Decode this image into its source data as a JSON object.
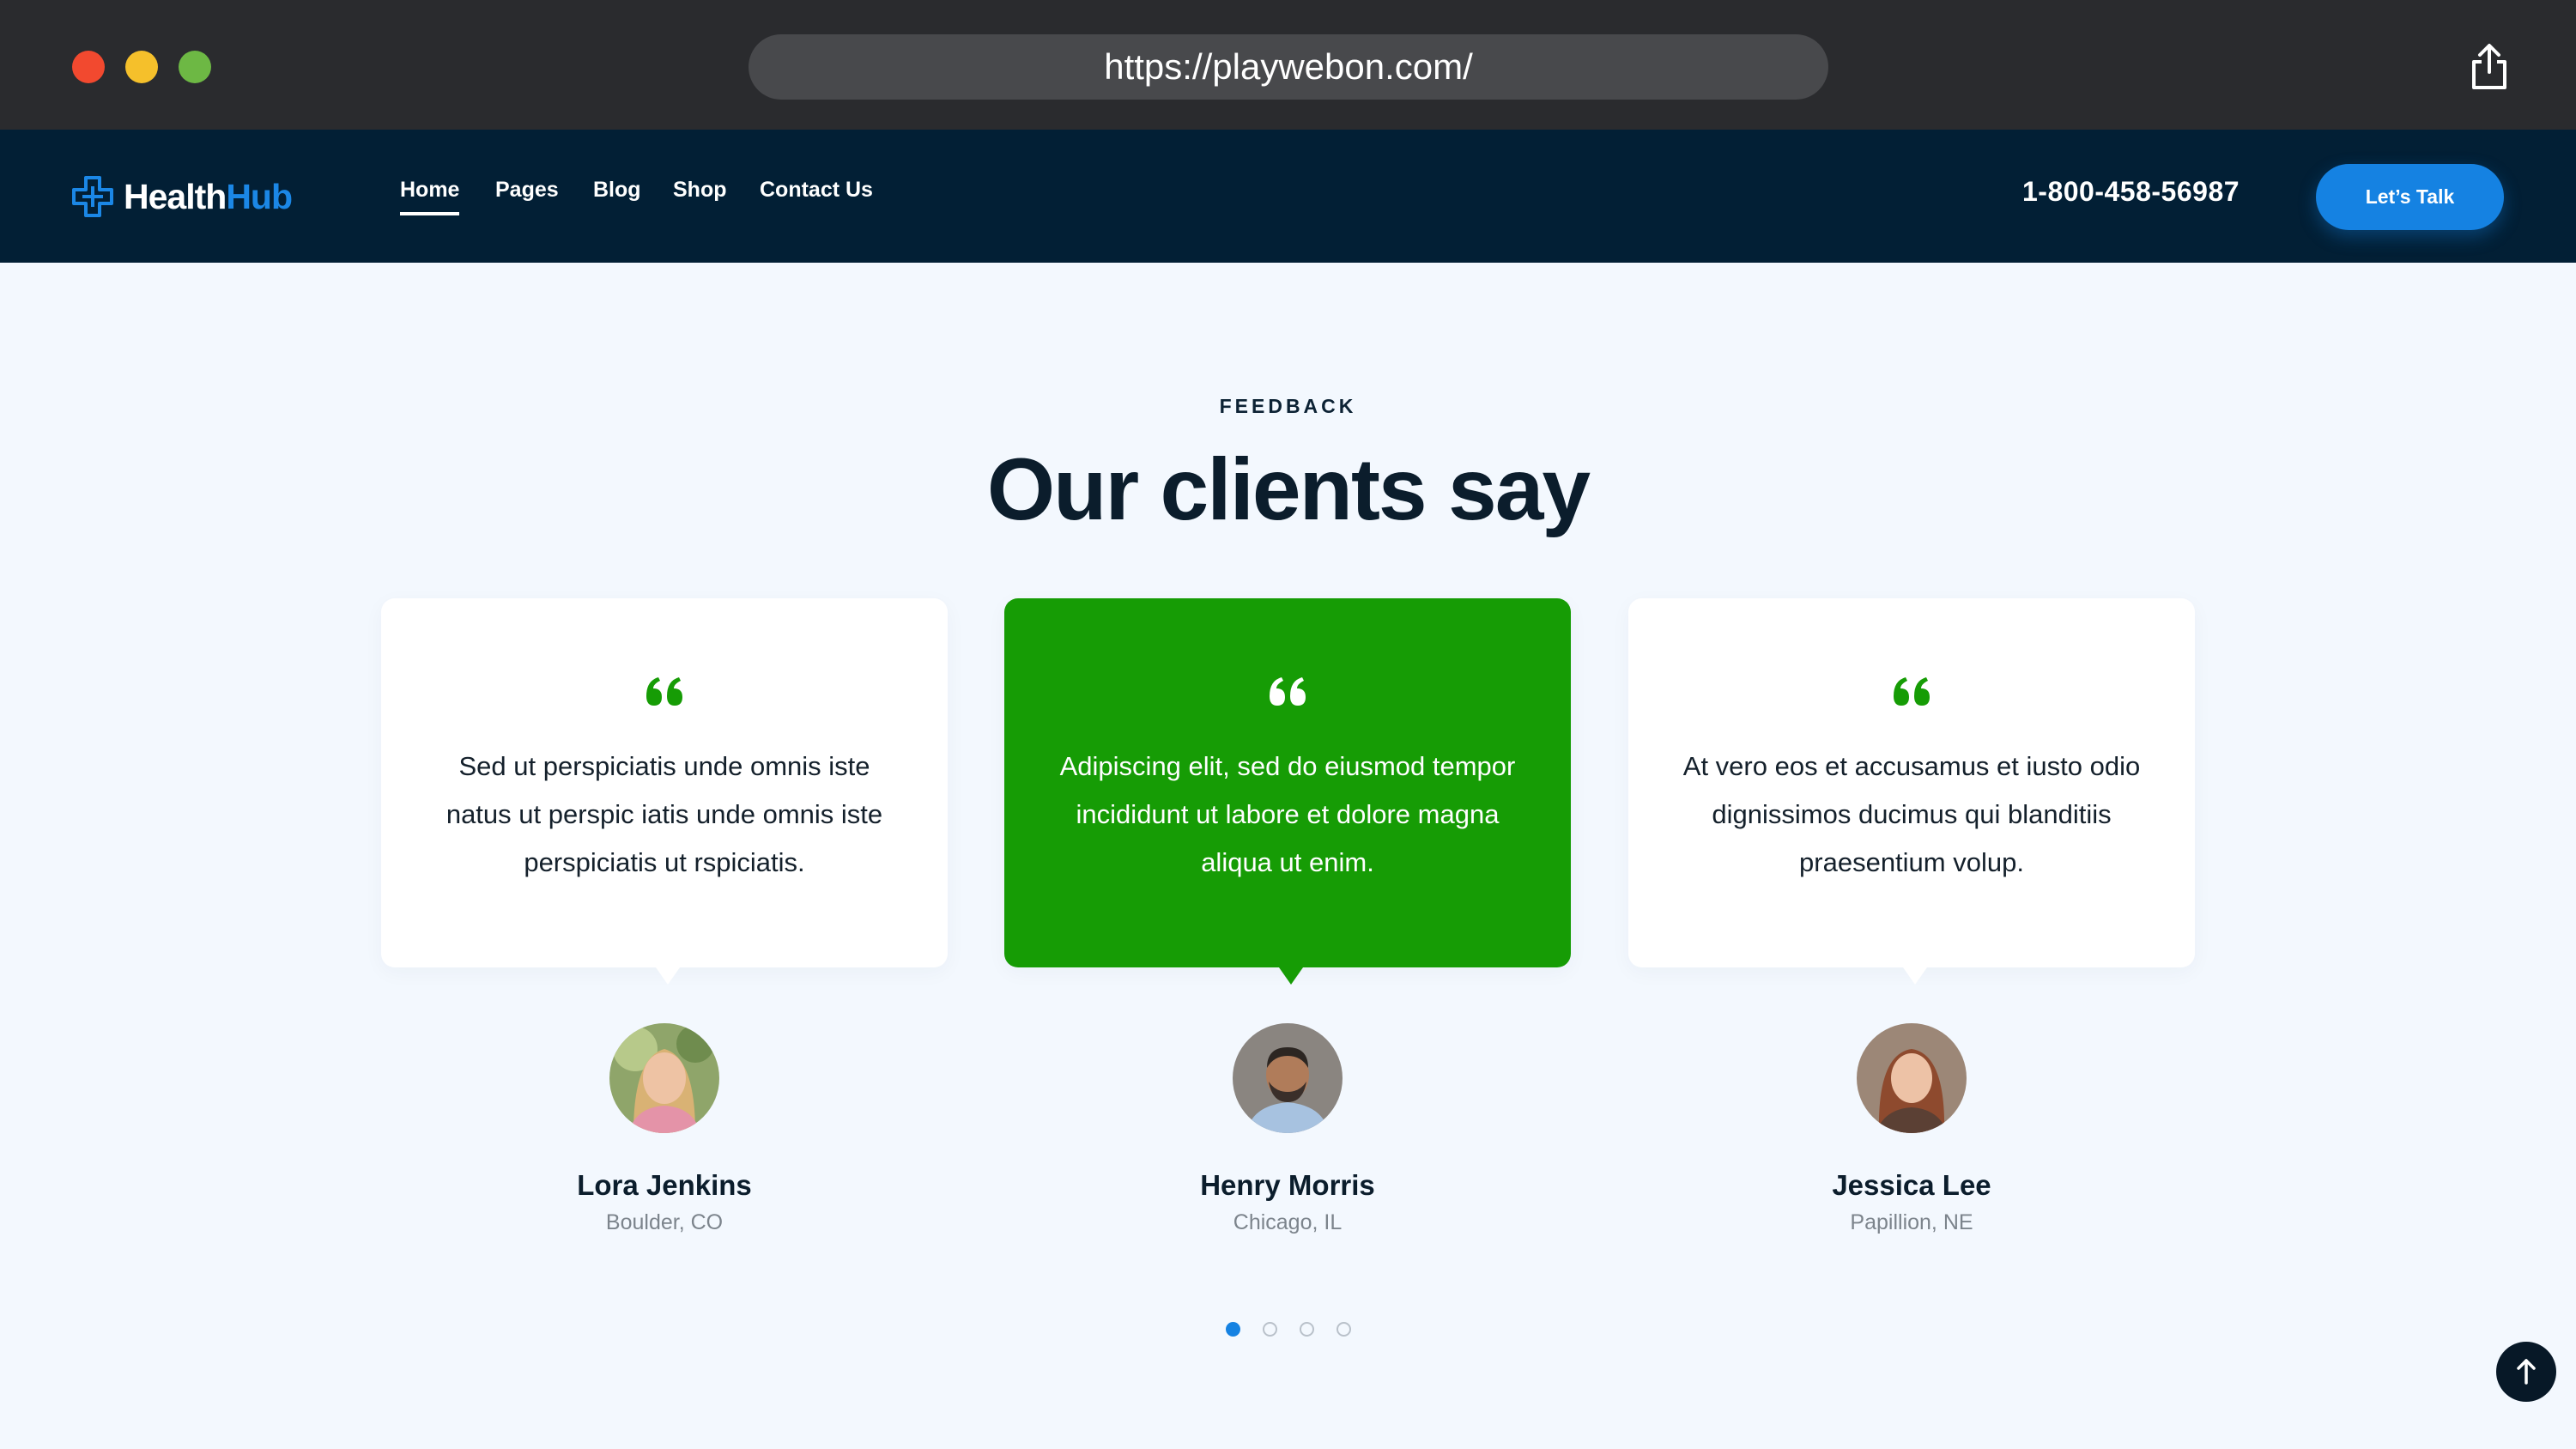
{
  "browser": {
    "url": "https://playwebon.com/",
    "traffic_lights": [
      "#f2492f",
      "#f5c02b",
      "#6db844"
    ],
    "share_icon": "share-icon"
  },
  "nav": {
    "logo_part1": "Health",
    "logo_part2": "Hub",
    "menu": [
      {
        "label": "Home",
        "active": true
      },
      {
        "label": "Pages",
        "active": false
      },
      {
        "label": "Blog",
        "active": false
      },
      {
        "label": "Shop",
        "active": false
      },
      {
        "label": "Contact Us",
        "active": false
      }
    ],
    "phone": "1-800-458-56987",
    "cta_label": "Let’s Talk"
  },
  "section": {
    "eyebrow": "FEEDBACK",
    "heading": "Our clients say"
  },
  "testimonials": [
    {
      "quote": "Sed ut perspiciatis unde omnis iste natus ut perspic iatis unde omnis iste perspiciatis ut rspiciatis.",
      "name": "Lora Jenkins",
      "location": "Boulder, CO",
      "featured": false
    },
    {
      "quote": "Adipiscing elit, sed do eiusmod tempor incididunt ut labore et dolore magna aliqua ut enim.",
      "name": "Henry Morris",
      "location": "Chicago, IL",
      "featured": true
    },
    {
      "quote": "At vero eos et accusamus et iusto odio dignissimos ducimus qui blanditiis praesentium volup.",
      "name": "Jessica Lee",
      "location": "Papillion, NE",
      "featured": false
    }
  ],
  "pagination": {
    "total": 4,
    "current": 1
  },
  "colors": {
    "nav_bg": "#021f35",
    "accent_blue": "#1582e2",
    "accent_green": "#169c05",
    "page_bg": "#f3f8fe"
  }
}
